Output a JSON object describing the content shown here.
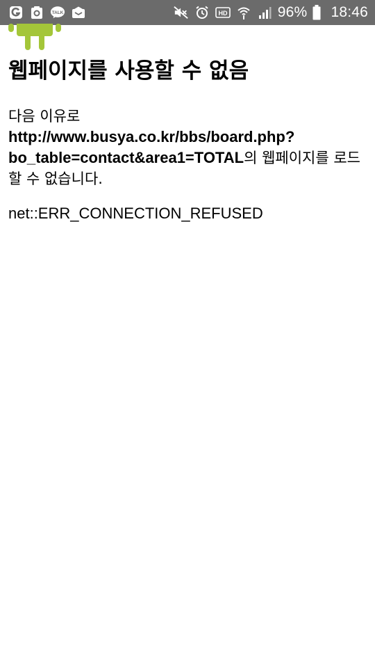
{
  "status_bar": {
    "battery_percent": "96%",
    "time": "18:46",
    "hd_label": "HD",
    "talk_label": "TALK",
    "icons": [
      "g-icon",
      "app-icon",
      "kakaotalk-icon",
      "mail-icon",
      "mute-icon",
      "alarm-icon",
      "hd-icon",
      "wifi-icon",
      "signal-icon",
      "battery-icon"
    ]
  },
  "page": {
    "title": "웹페이지를 사용할 수 없음",
    "reason_prefix": "다음 이유로",
    "url": "http://www.busya.co.kr/bbs/board.php?bo_table=contact&area1=TOTAL",
    "reason_suffix": "의 웹페이지를 로드할 수 없습니다.",
    "error_code": "net::ERR_CONNECTION_REFUSED"
  },
  "colors": {
    "status_bar": "#6b6b6b",
    "android_green": "#a4c639",
    "background": "#ffffff",
    "text": "#000000"
  }
}
